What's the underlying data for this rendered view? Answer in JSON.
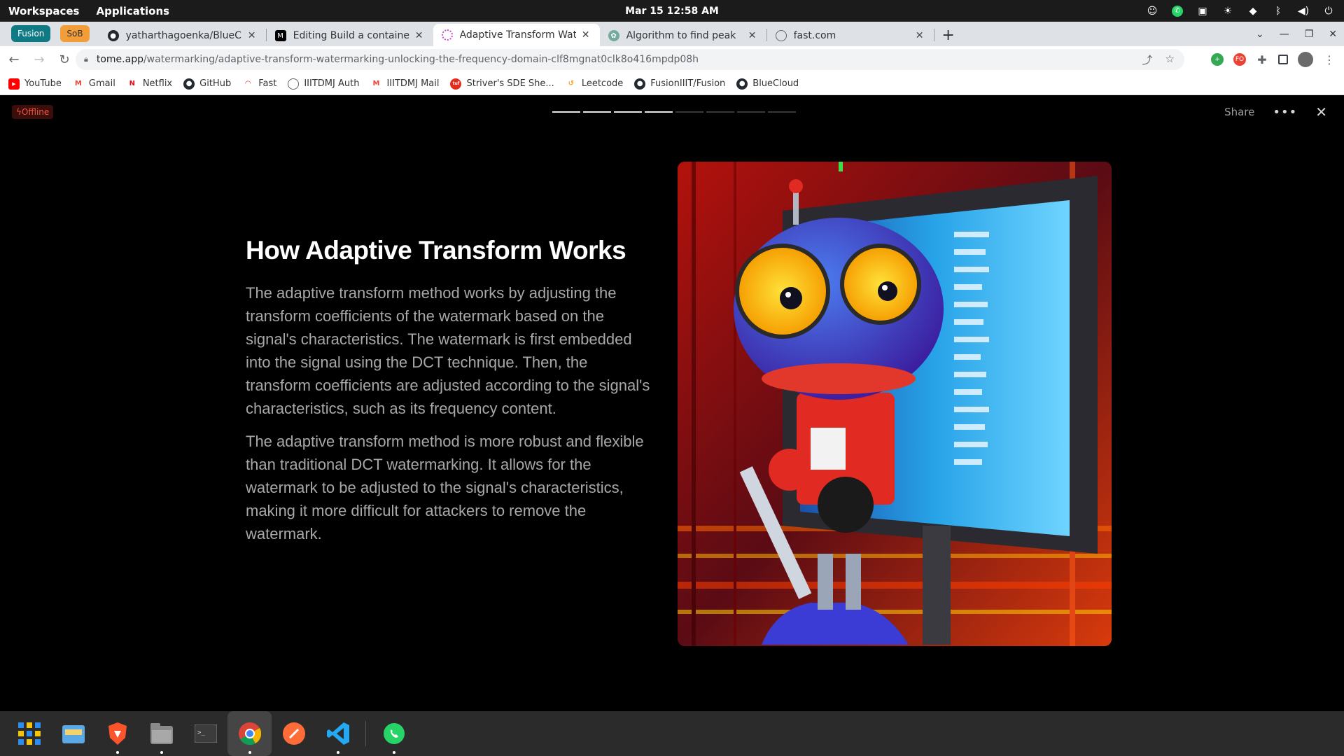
{
  "topbar": {
    "workspaces": "Workspaces",
    "applications": "Applications",
    "clock": "Mar 15  12:58 AM"
  },
  "tabs": {
    "groups": [
      "Fusion",
      "SoB"
    ],
    "items": [
      {
        "title": "yatharthagoenka/BlueCloud",
        "icon": "github-icon"
      },
      {
        "title": "Editing Build a containerized",
        "icon": "medium-icon"
      },
      {
        "title": "Adaptive Transform Watermar",
        "icon": "tome-icon",
        "active": true
      },
      {
        "title": "Algorithm to find peak",
        "icon": "openai-icon"
      },
      {
        "title": "fast.com",
        "icon": "globe-icon"
      }
    ]
  },
  "omnibox": {
    "host": "tome.app",
    "path": "/watermarking/adaptive-transform-watermarking-unlocking-the-frequency-domain-clf8mgnat0clk8o416mpdp08h"
  },
  "bookmarks": [
    {
      "label": "YouTube",
      "icon": "youtube-icon"
    },
    {
      "label": "Gmail",
      "icon": "gmail-icon"
    },
    {
      "label": "Netflix",
      "icon": "netflix-icon"
    },
    {
      "label": "GitHub",
      "icon": "github-icon"
    },
    {
      "label": "Fast",
      "icon": "fast-icon"
    },
    {
      "label": "IIITDMJ Auth",
      "icon": "globe-icon"
    },
    {
      "label": "IIITDMJ Mail",
      "icon": "gmail-icon"
    },
    {
      "label": "Striver's SDE She...",
      "icon": "tuf-icon"
    },
    {
      "label": "Leetcode",
      "icon": "leetcode-icon"
    },
    {
      "label": "FusionIIIT/Fusion",
      "icon": "github-icon"
    },
    {
      "label": "BlueCloud",
      "icon": "github-icon"
    }
  ],
  "page": {
    "offline_badge": "Offline",
    "share": "Share",
    "progress_total": 8,
    "progress_done": 4,
    "title": "How Adaptive Transform Works",
    "paragraphs": [
      "The adaptive transform method works by adjusting the transform coefficients of the watermark based on the signal's characteristics. The watermark is first embedded into the signal using the DCT technique. Then, the transform coefficients are adjusted according to the signal's characteristics, such as its frequency content.",
      "The adaptive transform method is more robust and flexible than traditional DCT watermarking. It allows for the watermark to be adjusted to the signal's characteristics, making it more difficult for attackers to remove the watermark."
    ]
  },
  "dock": [
    {
      "name": "app-grid-icon"
    },
    {
      "name": "file-manager-icon"
    },
    {
      "name": "brave-icon"
    },
    {
      "name": "files-icon"
    },
    {
      "name": "terminal-icon"
    },
    {
      "name": "chrome-icon"
    },
    {
      "name": "postman-icon"
    },
    {
      "name": "vscode-icon"
    },
    {
      "name": "whatsapp-icon"
    }
  ]
}
